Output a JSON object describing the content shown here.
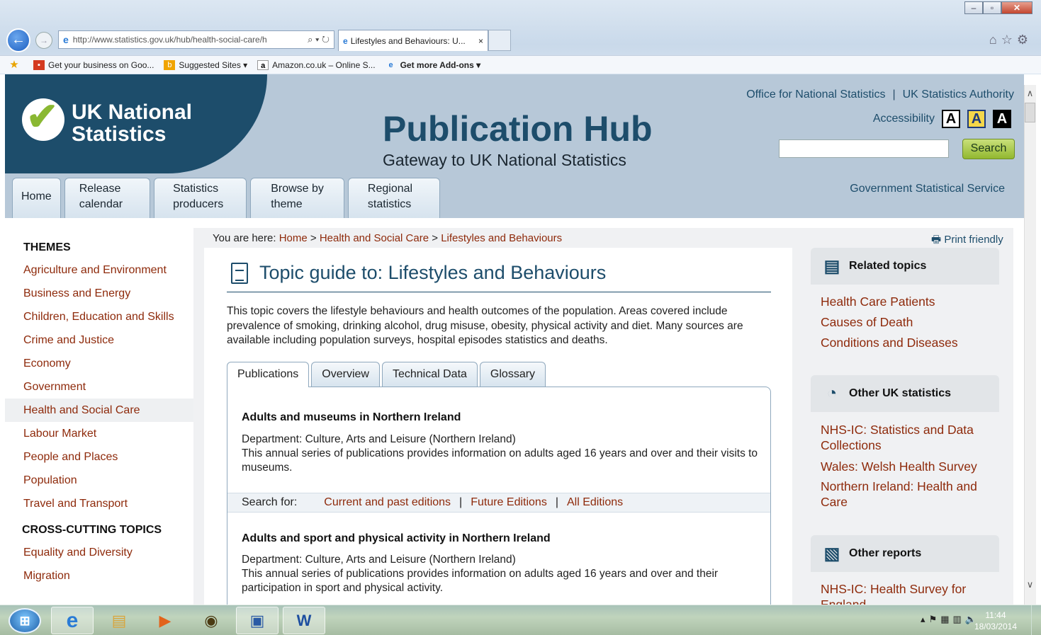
{
  "browser": {
    "url": "http://www.statistics.gov.uk/hub/health-social-care/h",
    "tab_title": "Lifestyles and Behaviours: U...",
    "favorites": [
      {
        "label": "Get your business on Goo...",
        "icon": "business-icon"
      },
      {
        "label": "Suggested Sites ▾",
        "icon": "bing-icon"
      },
      {
        "label": "Amazon.co.uk – Online S...",
        "icon": "amazon-icon"
      },
      {
        "label": "Get more Add-ons ▾",
        "icon": "ie-icon"
      }
    ]
  },
  "header": {
    "logo_line1": "UK National",
    "logo_line2": "Statistics",
    "title": "Publication Hub",
    "subtitle": "Gateway to UK National Statistics",
    "link_ons": "Office for National Statistics",
    "link_authority": "UK Statistics Authority",
    "accessibility": "Accessibility",
    "text_size_labels": [
      "A",
      "A",
      "A"
    ],
    "search_button": "Search",
    "gss": "Government Statistical Service",
    "nav": [
      {
        "line1": "Home",
        "line2": ""
      },
      {
        "line1": "Release",
        "line2": "calendar"
      },
      {
        "line1": "Statistics",
        "line2": "producers"
      },
      {
        "line1": "Browse by",
        "line2": "theme"
      },
      {
        "line1": "Regional",
        "line2": "statistics"
      }
    ]
  },
  "sidebar": {
    "themes_heading": "THEMES",
    "themes": [
      "Agriculture and Environment",
      "Business and Energy",
      "Children, Education and Skills",
      "Crime and Justice",
      "Economy",
      "Government",
      "Health and Social Care",
      "Labour Market",
      "People and Places",
      "Population",
      "Travel and Transport"
    ],
    "cross_heading": "CROSS-CUTTING TOPICS",
    "cross": [
      "Equality and Diversity",
      "Migration"
    ]
  },
  "main": {
    "breadcrumb_prefix": "You are here: ",
    "breadcrumb": [
      "Home",
      "Health and Social Care",
      "Lifestyles and Behaviours"
    ],
    "breadcrumb_sep": " > ",
    "print": "Print friendly",
    "title": "Topic guide to: Lifestyles and Behaviours",
    "intro": "This topic covers the lifestyle behaviours and health outcomes of the population. Areas covered include prevalence of smoking, drinking alcohol, drug misuse, obesity, physical activity and diet. Many sources are available including population surveys, hospital episodes statistics and deaths.",
    "tabs": [
      "Publications",
      "Overview",
      "Technical Data",
      "Glossary"
    ],
    "publications": [
      {
        "title": "Adults and museums in Northern Ireland",
        "dept": "Department: Culture, Arts and Leisure (Northern Ireland)",
        "desc": "This annual series of publications provides information on adults aged 16 years and over and their visits to museums."
      },
      {
        "title": "Adults and sport and physical activity in Northern Ireland",
        "dept": "Department: Culture, Arts and Leisure (Northern Ireland)",
        "desc": "This annual series of publications provides information on adults aged 16 years and over and their participation in sport and physical activity."
      }
    ],
    "search_for": {
      "label": "Search for:",
      "links": [
        "Current and past editions",
        "Future Editions",
        "All Editions"
      ]
    }
  },
  "right": {
    "related_heading": "Related topics",
    "related": [
      "Health Care Patients",
      "Causes of Death",
      "Conditions and Diseases"
    ],
    "other_uk_heading": "Other UK statistics",
    "other_uk": [
      "NHS-IC: Statistics and Data Collections",
      "Wales: Welsh Health Survey",
      "Northern Ireland: Health and Care"
    ],
    "reports_heading": "Other reports",
    "reports": [
      "NHS-IC: Health Survey for England"
    ]
  },
  "taskbar": {
    "time": "11:44",
    "date": "18/03/2014"
  },
  "colors": {
    "brand_dark": "#1d4d6b",
    "link": "#8e2a0b",
    "header_bg": "#b7c8d8"
  }
}
